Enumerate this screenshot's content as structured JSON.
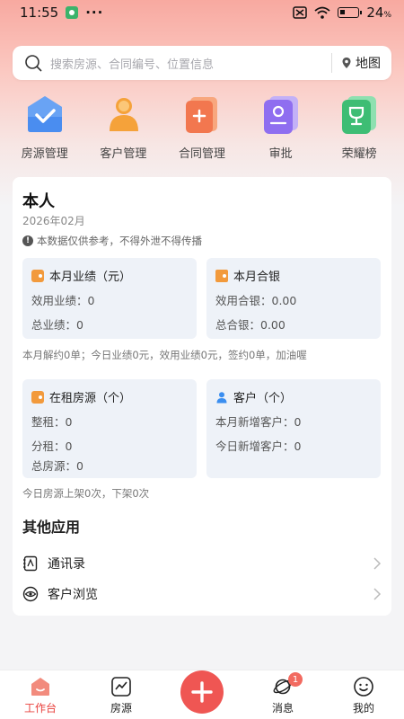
{
  "status_bar": {
    "time": "11:55",
    "battery_pct": "24",
    "battery_suffix": "%"
  },
  "search": {
    "placeholder": "搜索房源、合同编号、位置信息",
    "map_label": "地图"
  },
  "quick": [
    {
      "label": "房源管理",
      "icon": "house-check-icon",
      "color": "#4a8df0"
    },
    {
      "label": "客户管理",
      "icon": "person-icon",
      "color": "#f5a23a"
    },
    {
      "label": "合同管理",
      "icon": "contract-add-icon",
      "color": "#f2774f"
    },
    {
      "label": "审批",
      "icon": "approval-icon",
      "color": "#8f6ef0"
    },
    {
      "label": "荣耀榜",
      "icon": "trophy-icon",
      "color": "#3ebd74"
    }
  ],
  "card": {
    "title": "本人",
    "date": "2026年02月",
    "notice": "本数据仅供参考，不得外泄不得传播",
    "performance": {
      "title": "本月业绩（元）",
      "line1": "效用业绩：0",
      "line2": "总业绩：0"
    },
    "contract": {
      "title": "本月合银",
      "line1": "效用合银：0.00",
      "line2": "总合银：0.00"
    },
    "summary1": "本月解约0单；今日业绩0元，效用业绩0元，签约0单，加油喔",
    "rentals": {
      "title": "在租房源（个）",
      "line1": "整租：0",
      "line2": "分租：0",
      "line3": "总房源：0"
    },
    "customers": {
      "title": "客户（个）",
      "line1": "本月新增客户：0",
      "line2": "今日新增客户：0"
    },
    "summary2": "今日房源上架0次，下架0次",
    "other_title": "其他应用",
    "contacts": "通讯录",
    "browse": "客户浏览"
  },
  "tabs": {
    "workbench": "工作台",
    "houses": "房源",
    "messages": "消息",
    "messages_badge": "1",
    "mine": "我的"
  },
  "colors": {
    "accent": "#e9403c",
    "fab": "#ef5653",
    "panel": "#eef2f8"
  }
}
